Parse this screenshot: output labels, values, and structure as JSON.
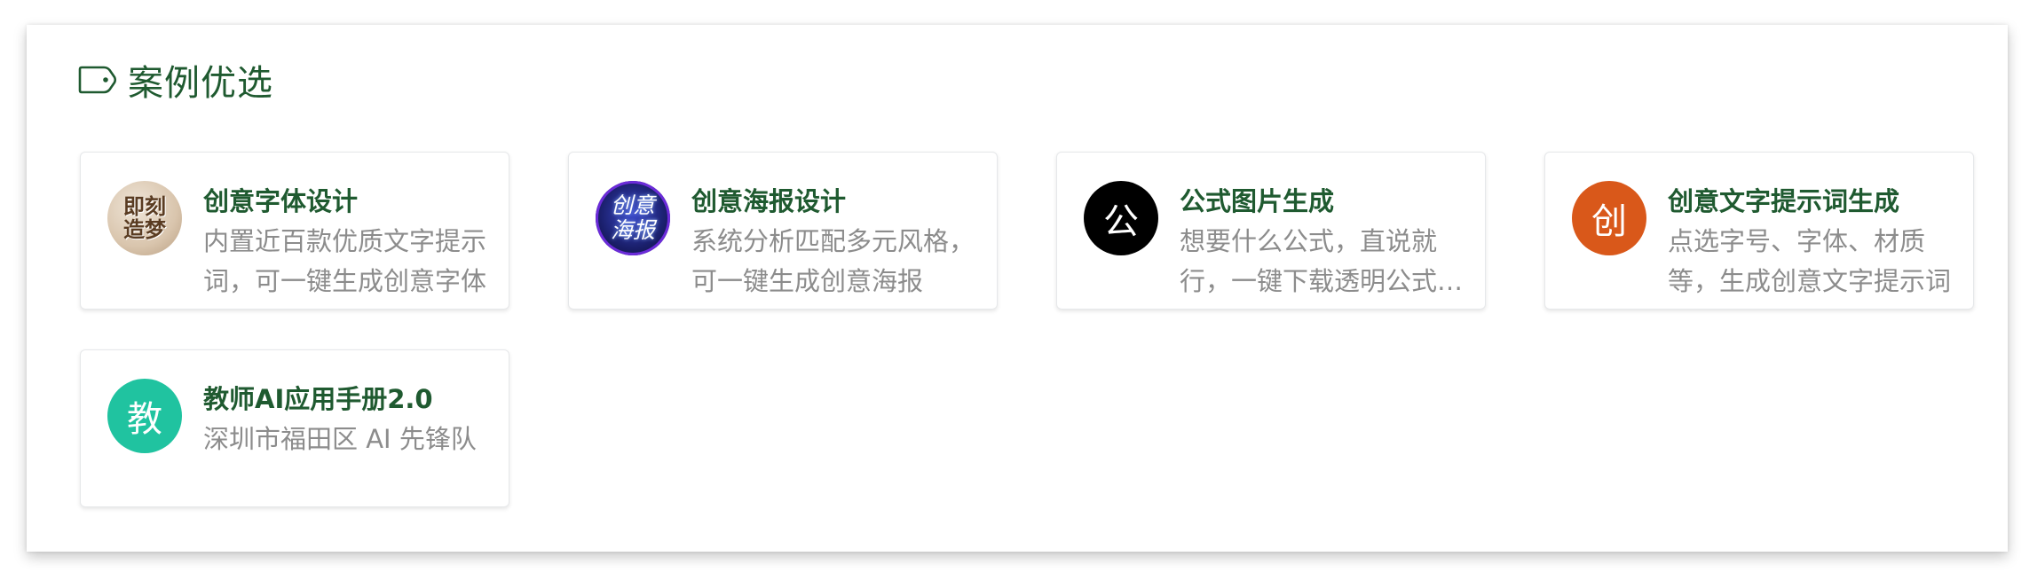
{
  "section": {
    "title": "案例优选",
    "icon": "tag-icon",
    "title_color": "#1f5a30"
  },
  "cards": [
    {
      "title": "创意字体设计",
      "description": "内置近百款优质文字提示词，可一键生成创意字体",
      "avatar_text": [
        "即刻",
        "造梦"
      ],
      "avatar_color": "#d9c7b3"
    },
    {
      "title": "创意海报设计",
      "description": "系统分析匹配多元风格，可一键生成创意海报",
      "avatar_text": [
        "创意",
        "海报"
      ],
      "avatar_color": "#1a1f6b"
    },
    {
      "title": "公式图片生成",
      "description": "想要什么公式，直说就行，一键下载透明公式图片",
      "avatar_text": "公",
      "avatar_color": "#000000"
    },
    {
      "title": "创意文字提示词生成",
      "description": "点选字号、字体、材质等，生成创意文字提示词",
      "avatar_text": "创",
      "avatar_color": "#d9581a"
    },
    {
      "title": "教师AI应用手册2.0",
      "description": "深圳市福田区 AI 先锋队",
      "avatar_text": "教",
      "avatar_color": "#20c3a0"
    }
  ]
}
